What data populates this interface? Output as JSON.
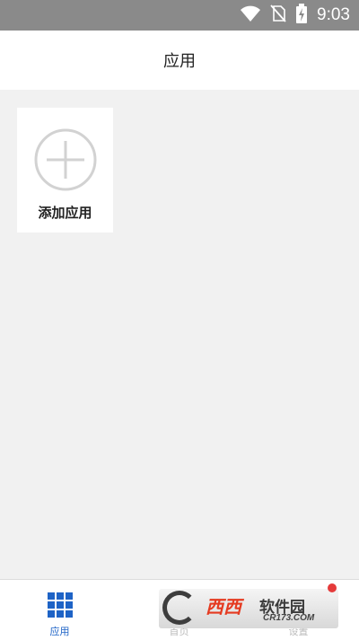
{
  "status_bar": {
    "time": "9:03",
    "icons": [
      "wifi-icon",
      "no-sim-icon",
      "battery-charging-icon"
    ]
  },
  "app_bar": {
    "title": "应用"
  },
  "content": {
    "add_tile": {
      "label": "添加应用",
      "icon": "plus-circle-icon"
    }
  },
  "bottom_nav": {
    "items": [
      {
        "label": "应用",
        "icon": "grid-icon",
        "active": true
      },
      {
        "label": "首页",
        "icon": "home-icon",
        "active": false
      },
      {
        "label": "设置",
        "icon": "settings-icon",
        "active": false
      }
    ]
  },
  "watermark": {
    "text": "西西",
    "text2": "软件园",
    "sub": "CR173.COM"
  },
  "colors": {
    "accent": "#1e63c6",
    "status_bar": "#8a8a8a",
    "background": "#f1f1f1",
    "inactive_label": "#bbbbbb"
  }
}
